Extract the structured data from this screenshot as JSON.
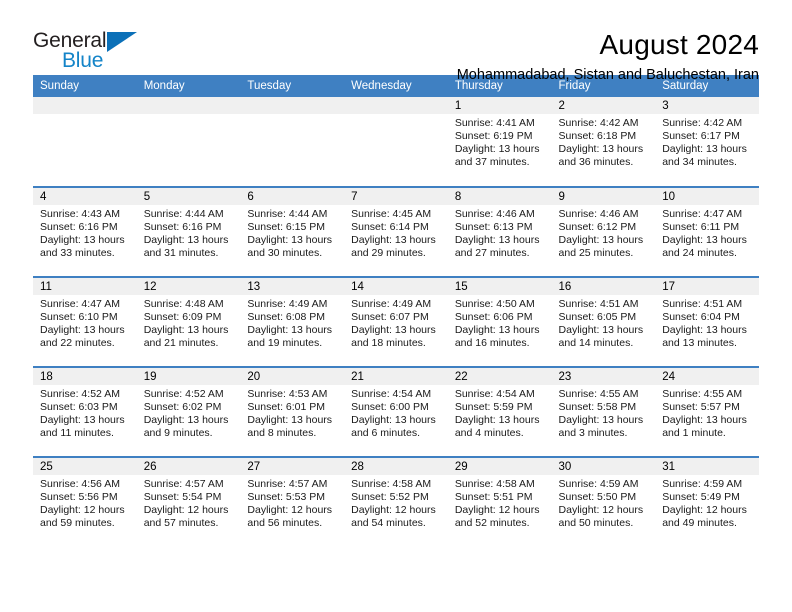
{
  "logo": {
    "word_one": "General",
    "word_two": "Blue",
    "triangle_color": "#0b70b8",
    "blue_text_color": "#1484c8"
  },
  "header": {
    "month_title": "August 2024",
    "location": "Mohammadabad, Sistan and Baluchestan, Iran"
  },
  "theme": {
    "header_blue": "#3f80c2",
    "daynum_gray": "#f0f0f0"
  },
  "calendar": {
    "weekday_headers": [
      "Sunday",
      "Monday",
      "Tuesday",
      "Wednesday",
      "Thursday",
      "Friday",
      "Saturday"
    ],
    "labels": {
      "sunrise_prefix": "Sunrise:",
      "sunset_prefix": "Sunset:",
      "daylight_prefix": "Daylight:"
    },
    "weeks": [
      [
        {
          "day": "",
          "empty": true
        },
        {
          "day": "",
          "empty": true
        },
        {
          "day": "",
          "empty": true
        },
        {
          "day": "",
          "empty": true
        },
        {
          "day": "1",
          "sunrise": "Sunrise: 4:41 AM",
          "sunset": "Sunset: 6:19 PM",
          "daylight_line1": "Daylight: 13 hours",
          "daylight_line2": "and 37 minutes."
        },
        {
          "day": "2",
          "sunrise": "Sunrise: 4:42 AM",
          "sunset": "Sunset: 6:18 PM",
          "daylight_line1": "Daylight: 13 hours",
          "daylight_line2": "and 36 minutes."
        },
        {
          "day": "3",
          "sunrise": "Sunrise: 4:42 AM",
          "sunset": "Sunset: 6:17 PM",
          "daylight_line1": "Daylight: 13 hours",
          "daylight_line2": "and 34 minutes."
        }
      ],
      [
        {
          "day": "4",
          "sunrise": "Sunrise: 4:43 AM",
          "sunset": "Sunset: 6:16 PM",
          "daylight_line1": "Daylight: 13 hours",
          "daylight_line2": "and 33 minutes."
        },
        {
          "day": "5",
          "sunrise": "Sunrise: 4:44 AM",
          "sunset": "Sunset: 6:16 PM",
          "daylight_line1": "Daylight: 13 hours",
          "daylight_line2": "and 31 minutes."
        },
        {
          "day": "6",
          "sunrise": "Sunrise: 4:44 AM",
          "sunset": "Sunset: 6:15 PM",
          "daylight_line1": "Daylight: 13 hours",
          "daylight_line2": "and 30 minutes."
        },
        {
          "day": "7",
          "sunrise": "Sunrise: 4:45 AM",
          "sunset": "Sunset: 6:14 PM",
          "daylight_line1": "Daylight: 13 hours",
          "daylight_line2": "and 29 minutes."
        },
        {
          "day": "8",
          "sunrise": "Sunrise: 4:46 AM",
          "sunset": "Sunset: 6:13 PM",
          "daylight_line1": "Daylight: 13 hours",
          "daylight_line2": "and 27 minutes."
        },
        {
          "day": "9",
          "sunrise": "Sunrise: 4:46 AM",
          "sunset": "Sunset: 6:12 PM",
          "daylight_line1": "Daylight: 13 hours",
          "daylight_line2": "and 25 minutes."
        },
        {
          "day": "10",
          "sunrise": "Sunrise: 4:47 AM",
          "sunset": "Sunset: 6:11 PM",
          "daylight_line1": "Daylight: 13 hours",
          "daylight_line2": "and 24 minutes."
        }
      ],
      [
        {
          "day": "11",
          "sunrise": "Sunrise: 4:47 AM",
          "sunset": "Sunset: 6:10 PM",
          "daylight_line1": "Daylight: 13 hours",
          "daylight_line2": "and 22 minutes."
        },
        {
          "day": "12",
          "sunrise": "Sunrise: 4:48 AM",
          "sunset": "Sunset: 6:09 PM",
          "daylight_line1": "Daylight: 13 hours",
          "daylight_line2": "and 21 minutes."
        },
        {
          "day": "13",
          "sunrise": "Sunrise: 4:49 AM",
          "sunset": "Sunset: 6:08 PM",
          "daylight_line1": "Daylight: 13 hours",
          "daylight_line2": "and 19 minutes."
        },
        {
          "day": "14",
          "sunrise": "Sunrise: 4:49 AM",
          "sunset": "Sunset: 6:07 PM",
          "daylight_line1": "Daylight: 13 hours",
          "daylight_line2": "and 18 minutes."
        },
        {
          "day": "15",
          "sunrise": "Sunrise: 4:50 AM",
          "sunset": "Sunset: 6:06 PM",
          "daylight_line1": "Daylight: 13 hours",
          "daylight_line2": "and 16 minutes."
        },
        {
          "day": "16",
          "sunrise": "Sunrise: 4:51 AM",
          "sunset": "Sunset: 6:05 PM",
          "daylight_line1": "Daylight: 13 hours",
          "daylight_line2": "and 14 minutes."
        },
        {
          "day": "17",
          "sunrise": "Sunrise: 4:51 AM",
          "sunset": "Sunset: 6:04 PM",
          "daylight_line1": "Daylight: 13 hours",
          "daylight_line2": "and 13 minutes."
        }
      ],
      [
        {
          "day": "18",
          "sunrise": "Sunrise: 4:52 AM",
          "sunset": "Sunset: 6:03 PM",
          "daylight_line1": "Daylight: 13 hours",
          "daylight_line2": "and 11 minutes."
        },
        {
          "day": "19",
          "sunrise": "Sunrise: 4:52 AM",
          "sunset": "Sunset: 6:02 PM",
          "daylight_line1": "Daylight: 13 hours",
          "daylight_line2": "and 9 minutes."
        },
        {
          "day": "20",
          "sunrise": "Sunrise: 4:53 AM",
          "sunset": "Sunset: 6:01 PM",
          "daylight_line1": "Daylight: 13 hours",
          "daylight_line2": "and 8 minutes."
        },
        {
          "day": "21",
          "sunrise": "Sunrise: 4:54 AM",
          "sunset": "Sunset: 6:00 PM",
          "daylight_line1": "Daylight: 13 hours",
          "daylight_line2": "and 6 minutes."
        },
        {
          "day": "22",
          "sunrise": "Sunrise: 4:54 AM",
          "sunset": "Sunset: 5:59 PM",
          "daylight_line1": "Daylight: 13 hours",
          "daylight_line2": "and 4 minutes."
        },
        {
          "day": "23",
          "sunrise": "Sunrise: 4:55 AM",
          "sunset": "Sunset: 5:58 PM",
          "daylight_line1": "Daylight: 13 hours",
          "daylight_line2": "and 3 minutes."
        },
        {
          "day": "24",
          "sunrise": "Sunrise: 4:55 AM",
          "sunset": "Sunset: 5:57 PM",
          "daylight_line1": "Daylight: 13 hours",
          "daylight_line2": "and 1 minute."
        }
      ],
      [
        {
          "day": "25",
          "sunrise": "Sunrise: 4:56 AM",
          "sunset": "Sunset: 5:56 PM",
          "daylight_line1": "Daylight: 12 hours",
          "daylight_line2": "and 59 minutes."
        },
        {
          "day": "26",
          "sunrise": "Sunrise: 4:57 AM",
          "sunset": "Sunset: 5:54 PM",
          "daylight_line1": "Daylight: 12 hours",
          "daylight_line2": "and 57 minutes."
        },
        {
          "day": "27",
          "sunrise": "Sunrise: 4:57 AM",
          "sunset": "Sunset: 5:53 PM",
          "daylight_line1": "Daylight: 12 hours",
          "daylight_line2": "and 56 minutes."
        },
        {
          "day": "28",
          "sunrise": "Sunrise: 4:58 AM",
          "sunset": "Sunset: 5:52 PM",
          "daylight_line1": "Daylight: 12 hours",
          "daylight_line2": "and 54 minutes."
        },
        {
          "day": "29",
          "sunrise": "Sunrise: 4:58 AM",
          "sunset": "Sunset: 5:51 PM",
          "daylight_line1": "Daylight: 12 hours",
          "daylight_line2": "and 52 minutes."
        },
        {
          "day": "30",
          "sunrise": "Sunrise: 4:59 AM",
          "sunset": "Sunset: 5:50 PM",
          "daylight_line1": "Daylight: 12 hours",
          "daylight_line2": "and 50 minutes."
        },
        {
          "day": "31",
          "sunrise": "Sunrise: 4:59 AM",
          "sunset": "Sunset: 5:49 PM",
          "daylight_line1": "Daylight: 12 hours",
          "daylight_line2": "and 49 minutes."
        }
      ]
    ]
  }
}
